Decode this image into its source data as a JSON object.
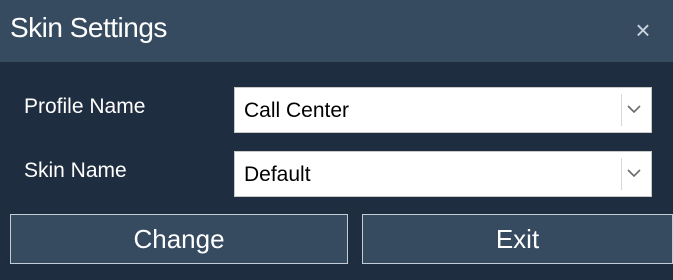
{
  "dialog": {
    "title": "Skin Settings",
    "close_symbol": "×"
  },
  "fields": {
    "profile_name": {
      "label": "Profile Name",
      "value": "Call Center"
    },
    "skin_name": {
      "label": "Skin Name",
      "value": "Default"
    }
  },
  "buttons": {
    "change_label": "Change",
    "exit_label": "Exit"
  },
  "colors": {
    "titlebar": "#364a60",
    "body": "#1e2d3f",
    "button": "#364a60",
    "text": "#ffffff"
  },
  "icons": {
    "close": "close-icon",
    "dropdown": "chevron-down-icon"
  }
}
